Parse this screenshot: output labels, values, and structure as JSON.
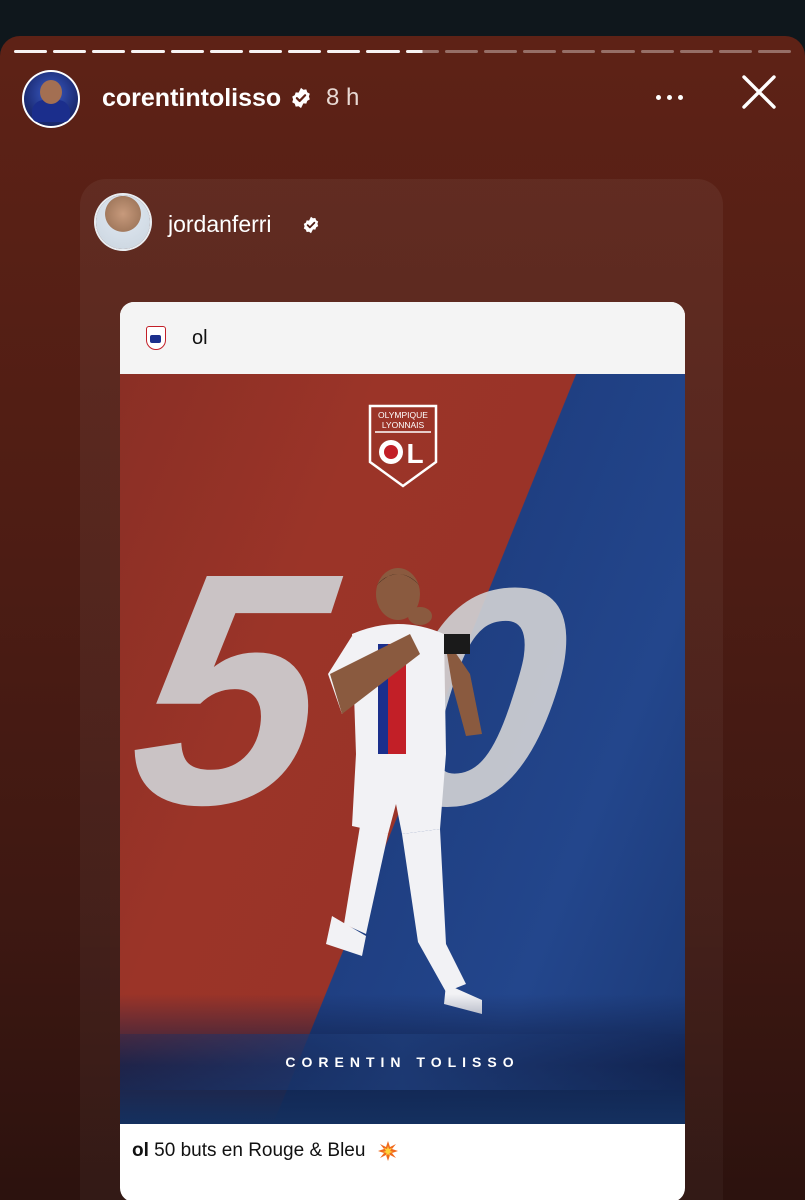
{
  "story": {
    "progress_total": 20,
    "progress_done": 11,
    "author": "corentintolisso",
    "time": "8 h"
  },
  "repost": {
    "author": "jordanferri",
    "post": {
      "account": "ol",
      "crest_text_line1": "OLYMPIQUE",
      "crest_text_line2": "LYONNAIS",
      "crest_letters": "OL",
      "number": "50",
      "number_digit1": "5",
      "number_digit2": "0",
      "player_name": "CORENTIN TOLISSO",
      "caption_user": "ol",
      "caption_text": "50 buts en Rouge & Bleu"
    }
  },
  "colors": {
    "story_bg": "#5e2216",
    "ol_red": "#c21f27",
    "ol_blue": "#1b2f8c"
  },
  "icons": {
    "verified": "verified-badge-icon",
    "more": "more-options-icon",
    "close": "close-icon",
    "spark": "collision-emoji-icon"
  }
}
